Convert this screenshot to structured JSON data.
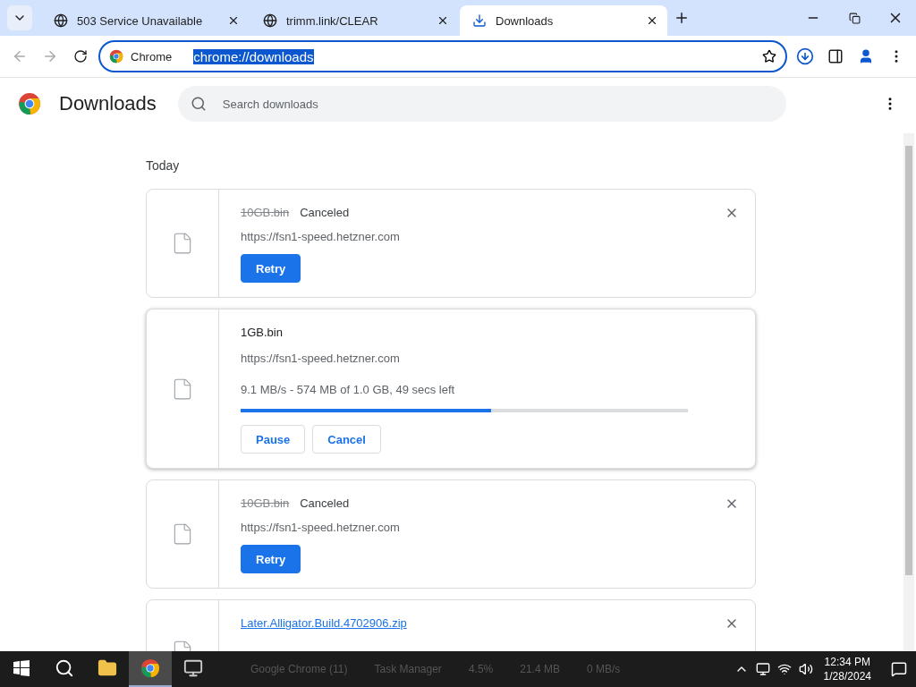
{
  "tabs": [
    {
      "title": "503 Service Unavailable",
      "kind": "web",
      "selected": false
    },
    {
      "title": "trimm.link/CLEAR",
      "kind": "web",
      "selected": false
    },
    {
      "title": "Downloads",
      "kind": "downloads",
      "selected": true
    }
  ],
  "address_bar": {
    "chip": "Chrome",
    "url": "chrome://downloads",
    "url_selected": true
  },
  "page": {
    "title": "Downloads",
    "search": {
      "placeholder": "Search downloads"
    },
    "section": "Today",
    "downloads": [
      {
        "kind": "canceled",
        "name": "10GB.bin",
        "status": "Canceled",
        "source": "https://fsn1-speed.hetzner.com",
        "buttons": [
          "Retry"
        ]
      },
      {
        "kind": "in_progress",
        "name": "1GB.bin",
        "source": "https://fsn1-speed.hetzner.com",
        "progress_text": "9.1 MB/s - 574 MB of 1.0 GB, 49 secs left",
        "level": 0.56,
        "buttons": [
          "Pause",
          "Cancel"
        ]
      },
      {
        "kind": "canceled",
        "name": "10GB.bin",
        "status": "Canceled",
        "source": "https://fsn1-speed.hetzner.com",
        "buttons": [
          "Retry"
        ]
      },
      {
        "kind": "completed",
        "name": "Later.Alligator.Build.4702906.zip"
      }
    ]
  },
  "taskbar": {
    "apps": [
      {
        "kind": "files",
        "selected": false
      },
      {
        "kind": "browser",
        "selected": true
      },
      {
        "kind": "monitor",
        "selected": false
      }
    ],
    "behind_text": [
      "Google Chrome (11)",
      "Task Manager",
      "4.5%",
      "21.4 MB",
      "0 MB/s"
    ],
    "time": "12:34 PM",
    "date": "1/28/2024"
  }
}
